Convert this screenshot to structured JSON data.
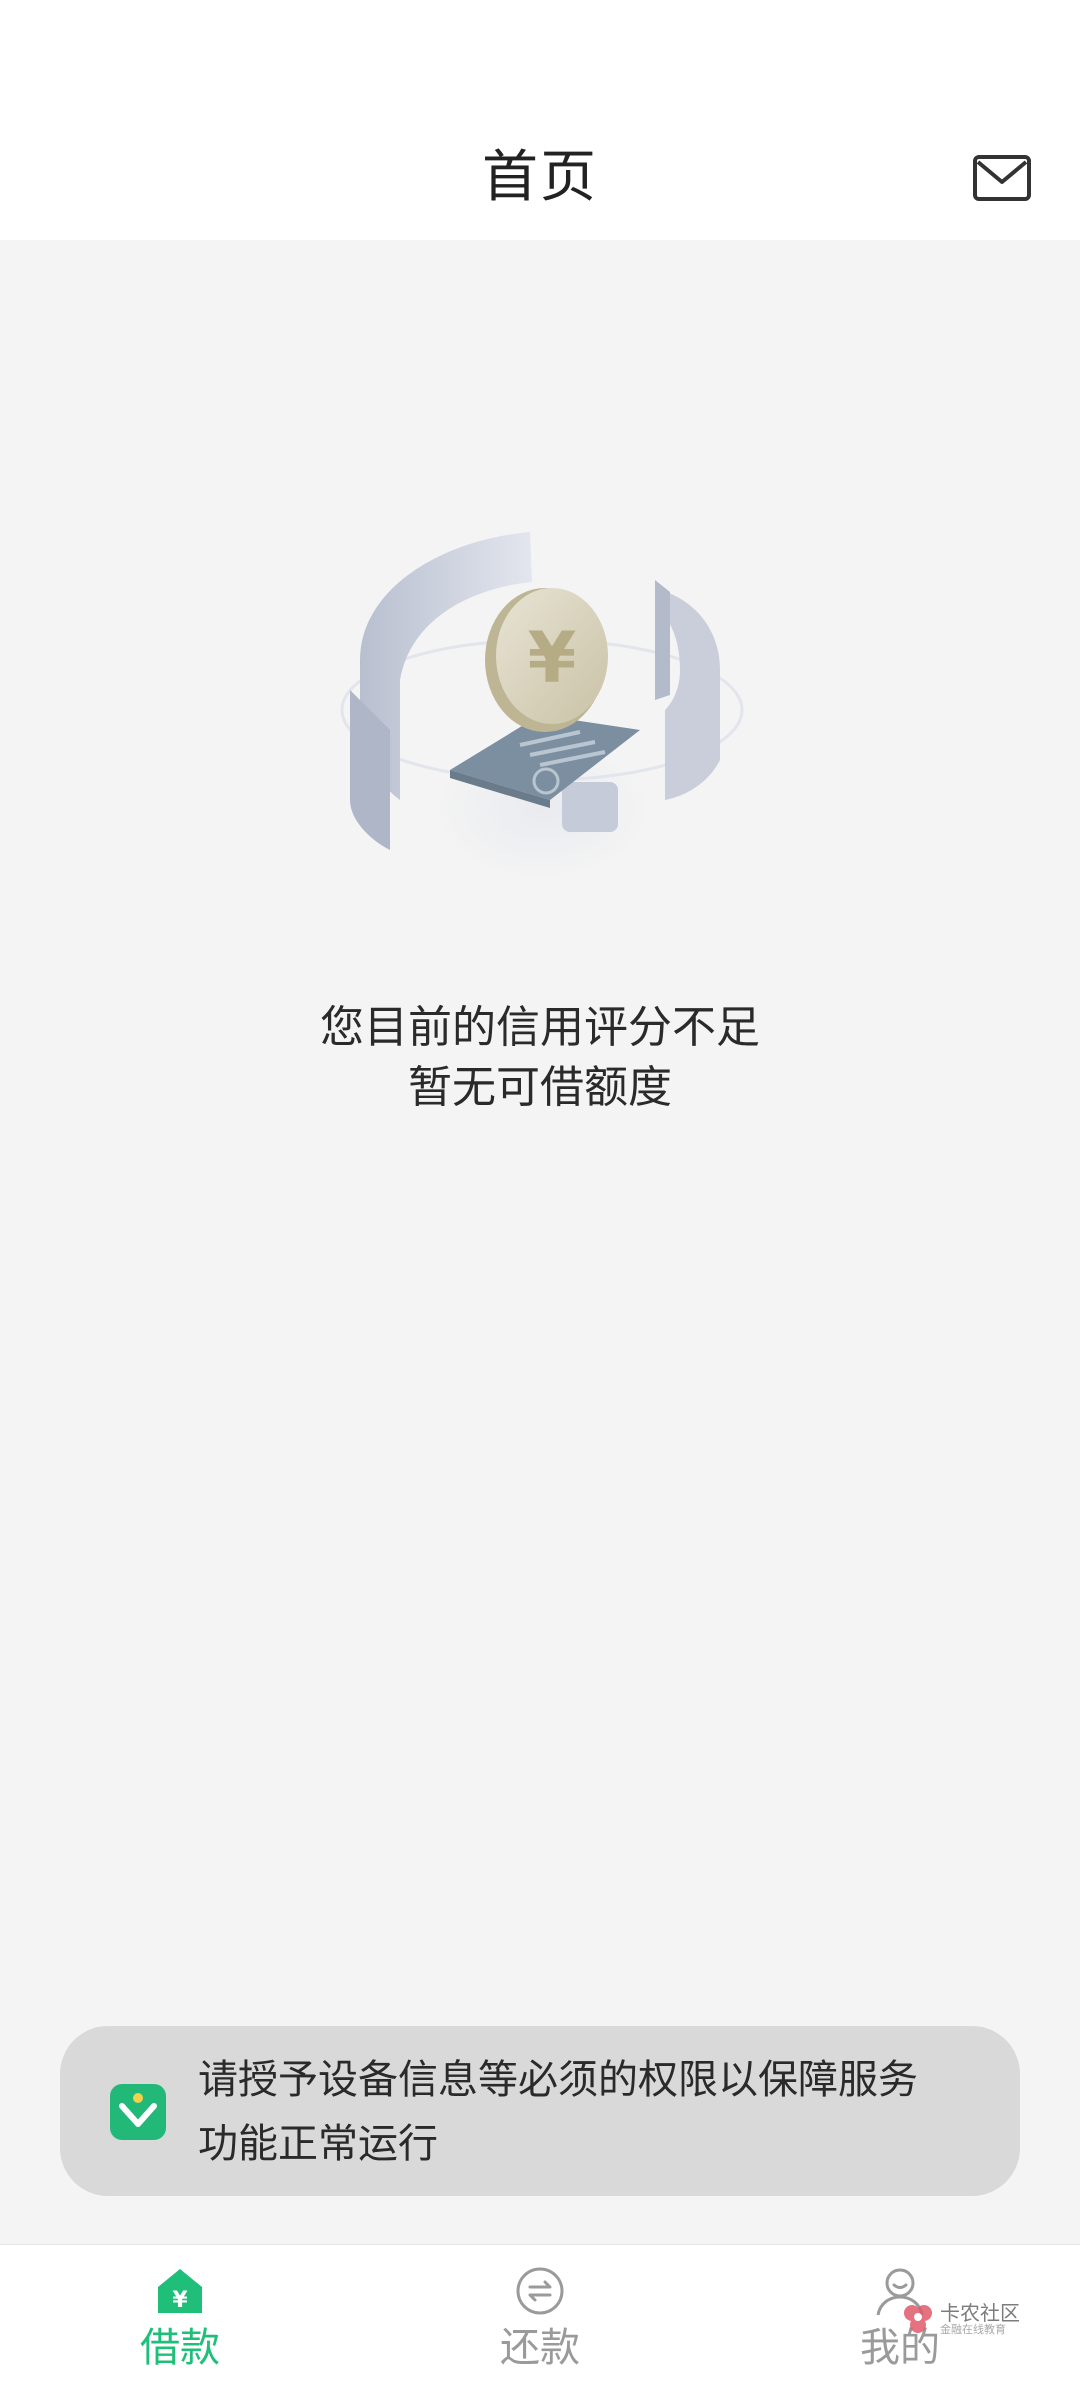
{
  "header": {
    "title": "首页",
    "mail_icon": "envelope-icon"
  },
  "empty_state": {
    "illustration_icon": "credit-coin-illustration",
    "line1": "您目前的信用评分不足",
    "line2": "暂无可借额度"
  },
  "toast": {
    "icon": "shield-check-icon",
    "line1": "请授予设备信息等必须的权限以保障服务",
    "line2": "功能正常运行"
  },
  "nav": {
    "items": [
      {
        "label": "借款",
        "icon": "home-yuan-icon",
        "active": true
      },
      {
        "label": "还款",
        "icon": "exchange-circle-icon",
        "active": false
      },
      {
        "label": "我的",
        "icon": "user-icon",
        "active": false
      }
    ]
  },
  "watermark": {
    "title": "卡农社区",
    "subtitle": "金融在线教育"
  },
  "colors": {
    "accent": "#1fbf7a",
    "background": "#f4f4f4",
    "toast_bg": "#d9d9d9",
    "inactive": "#9a9a9a"
  }
}
